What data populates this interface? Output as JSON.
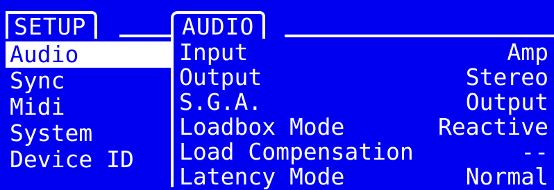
{
  "left_panel": {
    "tab_label": "SETUP",
    "items": [
      {
        "label": "Audio",
        "selected": true
      },
      {
        "label": "Sync",
        "selected": false
      },
      {
        "label": "Midi",
        "selected": false
      },
      {
        "label": "System",
        "selected": false
      },
      {
        "label": "Device ID",
        "selected": false
      }
    ]
  },
  "right_panel": {
    "tab_label": "AUDIO",
    "params": [
      {
        "name": "Input",
        "value": "Amp"
      },
      {
        "name": "Output",
        "value": "Stereo"
      },
      {
        "name": "S.G.A.",
        "value": "Output"
      },
      {
        "name": "Loadbox Mode",
        "value": "Reactive"
      },
      {
        "name": "Load Compensation",
        "value": "--"
      },
      {
        "name": "Latency Mode",
        "value": "Normal"
      }
    ]
  },
  "colors": {
    "background": "#0000f0",
    "foreground": "#ffffff"
  }
}
